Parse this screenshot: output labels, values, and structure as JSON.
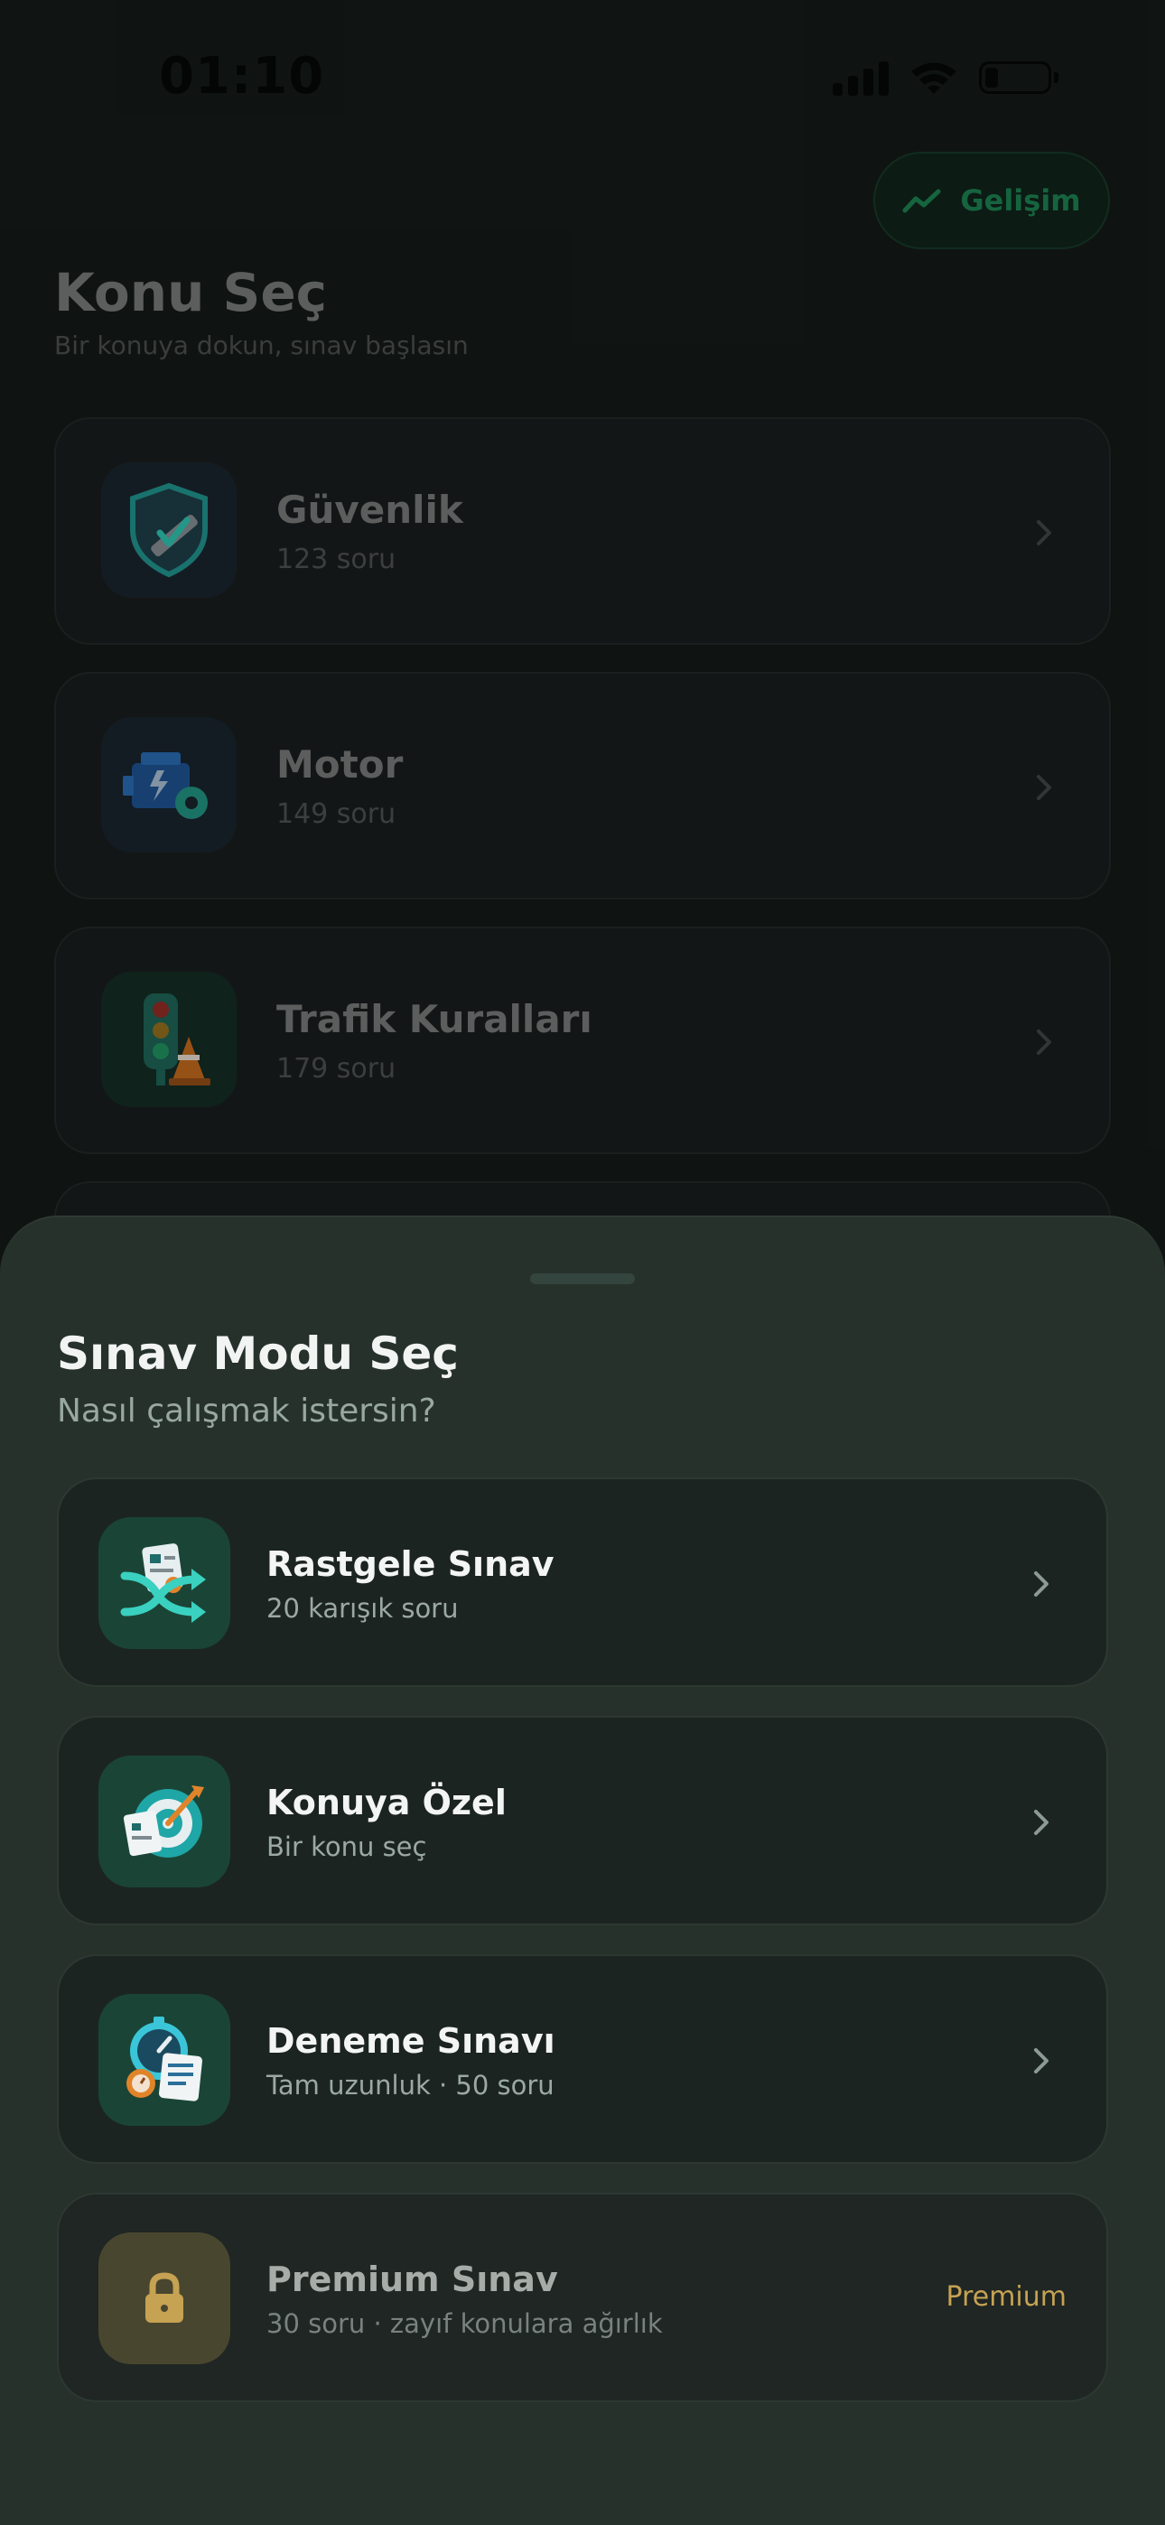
{
  "status_bar": {
    "time": "01:10",
    "battery_level": 0.15
  },
  "header": {
    "progress_button_label": "Gelişim",
    "title": "Konu Seç",
    "subtitle": "Bir konuya dokun, sınav başlasın"
  },
  "topics": [
    {
      "name": "Güvenlik",
      "count": "123 soru",
      "icon": "safety-shield-seatbelt-icon"
    },
    {
      "name": "Motor",
      "count": "149 soru",
      "icon": "engine-gear-icon"
    },
    {
      "name": "Trafik Kuralları",
      "count": "179 soru",
      "icon": "traffic-light-cone-icon"
    }
  ],
  "sheet": {
    "title": "Sınav Modu Seç",
    "subtitle": "Nasıl çalışmak istersin?",
    "modes": [
      {
        "name": "Rastgele Sınav",
        "desc": "20 karışık soru",
        "icon": "shuffle-document-icon"
      },
      {
        "name": "Konuya Özel",
        "desc": "Bir konu seç",
        "icon": "target-document-icon"
      },
      {
        "name": "Deneme Sınavı",
        "desc": "Tam uzunluk · 50 soru",
        "icon": "stopwatch-document-icon"
      },
      {
        "name": "Premium Sınav",
        "desc": "30 soru · zayıf konulara ağırlık",
        "icon": "lock-icon",
        "badge": "Premium",
        "locked": true
      }
    ]
  },
  "colors": {
    "accent_green": "#1b7a4e",
    "sheet_background": "#26312c",
    "card_background": "#1c2421",
    "premium_gold": "#c6a253"
  }
}
